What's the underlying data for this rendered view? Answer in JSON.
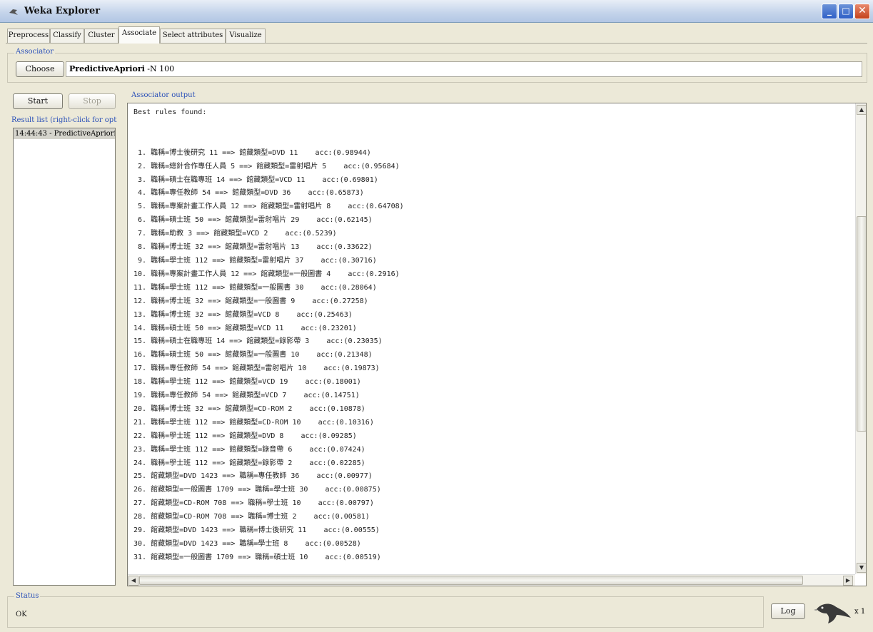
{
  "window": {
    "title": "Weka Explorer",
    "min_glyph": "_",
    "max_glyph": "□",
    "close_glyph": "✕"
  },
  "tabs": [
    {
      "label": "Preprocess"
    },
    {
      "label": "Classify"
    },
    {
      "label": "Cluster"
    },
    {
      "label": "Associate",
      "active": true
    },
    {
      "label": "Select attributes"
    },
    {
      "label": "Visualize"
    }
  ],
  "associator": {
    "group_label": "Associator",
    "choose_label": "Choose",
    "name": "PredictiveApriori",
    "options": "-N 100"
  },
  "controls": {
    "start_label": "Start",
    "stop_label": "Stop"
  },
  "result_list": {
    "label": "Result list (right-click for optic",
    "items": [
      "14:44:43 - PredictiveApriori"
    ]
  },
  "output": {
    "label": "Associator output",
    "header": "Best rules found:",
    "rules": [
      " 1. 職稱=博士後研究 11 ==> 館藏類型=DVD 11    acc:(0.98944)",
      " 2. 職稱=總針合作專任人員 5 ==> 館藏類型=雷射唱片 5    acc:(0.95684)",
      " 3. 職稱=碩士在職專班 14 ==> 館藏類型=VCD 11    acc:(0.69801)",
      " 4. 職稱=專任教師 54 ==> 館藏類型=DVD 36    acc:(0.65873)",
      " 5. 職稱=專案計畫工作人員 12 ==> 館藏類型=雷射唱片 8    acc:(0.64708)",
      " 6. 職稱=碩士班 50 ==> 館藏類型=雷射唱片 29    acc:(0.62145)",
      " 7. 職稱=助教 3 ==> 館藏類型=VCD 2    acc:(0.5239)",
      " 8. 職稱=博士班 32 ==> 館藏類型=雷射唱片 13    acc:(0.33622)",
      " 9. 職稱=學士班 112 ==> 館藏類型=雷射唱片 37    acc:(0.30716)",
      "10. 職稱=專案計畫工作人員 12 ==> 館藏類型=一般圖書 4    acc:(0.2916)",
      "11. 職稱=學士班 112 ==> 館藏類型=一般圖書 30    acc:(0.28064)",
      "12. 職稱=博士班 32 ==> 館藏類型=一般圖書 9    acc:(0.27258)",
      "13. 職稱=博士班 32 ==> 館藏類型=VCD 8    acc:(0.25463)",
      "14. 職稱=碩士班 50 ==> 館藏類型=VCD 11    acc:(0.23201)",
      "15. 職稱=碩士在職專班 14 ==> 館藏類型=錄影帶 3    acc:(0.23035)",
      "16. 職稱=碩士班 50 ==> 館藏類型=一般圖書 10    acc:(0.21348)",
      "17. 職稱=專任教師 54 ==> 館藏類型=雷射唱片 10    acc:(0.19873)",
      "18. 職稱=學士班 112 ==> 館藏類型=VCD 19    acc:(0.18001)",
      "19. 職稱=專任教師 54 ==> 館藏類型=VCD 7    acc:(0.14751)",
      "20. 職稱=博士班 32 ==> 館藏類型=CD-ROM 2    acc:(0.10878)",
      "21. 職稱=學士班 112 ==> 館藏類型=CD-ROM 10    acc:(0.10316)",
      "22. 職稱=學士班 112 ==> 館藏類型=DVD 8    acc:(0.09285)",
      "23. 職稱=學士班 112 ==> 館藏類型=錄音帶 6    acc:(0.07424)",
      "24. 職稱=學士班 112 ==> 館藏類型=錄影帶 2    acc:(0.02285)",
      "25. 館藏類型=DVD 1423 ==> 職稱=專任教師 36    acc:(0.00977)",
      "26. 館藏類型=一般圖書 1709 ==> 職稱=學士班 30    acc:(0.00875)",
      "27. 館藏類型=CD-ROM 708 ==> 職稱=學士班 10    acc:(0.00797)",
      "28. 館藏類型=CD-ROM 708 ==> 職稱=博士班 2    acc:(0.00581)",
      "29. 館藏類型=DVD 1423 ==> 職稱=博士後研究 11    acc:(0.00555)",
      "30. 館藏類型=DVD 1423 ==> 職稱=學士班 8    acc:(0.00528)",
      "31. 館藏類型=一般圖書 1709 ==> 職稱=碩士班 10    acc:(0.00519)"
    ]
  },
  "status": {
    "label": "Status",
    "text": "OK",
    "log_label": "Log",
    "multiplier": "x 1"
  },
  "colors": {
    "group_label": "#2a50b8",
    "background": "#ece9d8"
  }
}
